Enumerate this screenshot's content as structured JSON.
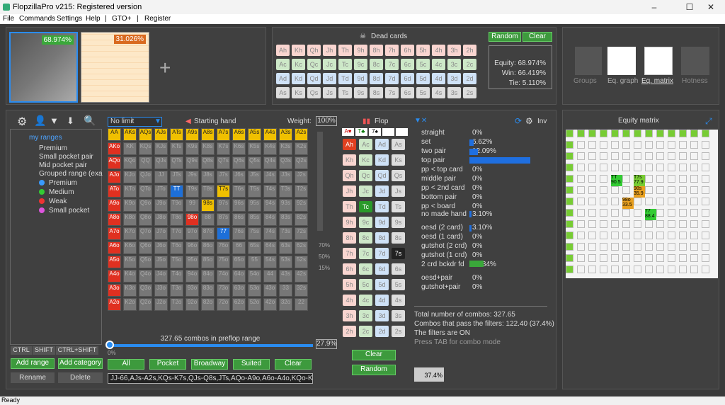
{
  "window": {
    "title": "FlopzillaPro v215: Registered version"
  },
  "menu": [
    "File",
    "Commands",
    "Settings",
    "Help",
    "|",
    "GTO+",
    "|",
    "Register"
  ],
  "ranges": {
    "r1_equity": "68.974%",
    "r2_equity": "31.026%"
  },
  "dead": {
    "title": "Dead cards",
    "random": "Random",
    "clear": "Clear",
    "rows": [
      [
        "Ah",
        "Kh",
        "Qh",
        "Jh",
        "Th",
        "9h",
        "8h",
        "7h",
        "6h",
        "5h",
        "4h",
        "3h",
        "2h"
      ],
      [
        "Ac",
        "Kc",
        "Qc",
        "Jc",
        "Tc",
        "9c",
        "8c",
        "7c",
        "6c",
        "5c",
        "4c",
        "3c",
        "2c"
      ],
      [
        "Ad",
        "Kd",
        "Qd",
        "Jd",
        "Td",
        "9d",
        "8d",
        "7d",
        "6d",
        "5d",
        "4d",
        "3d",
        "2d"
      ],
      [
        "As",
        "Ks",
        "Qs",
        "Js",
        "Ts",
        "9s",
        "8s",
        "7s",
        "6s",
        "5s",
        "4s",
        "3s",
        "2s"
      ]
    ],
    "equity": "Equity: 68.974%",
    "win": "Win: 66.419%",
    "tie": "Tie: 5.110%"
  },
  "views": {
    "groups": "Groups",
    "eqgraph": "Eq. graph",
    "eqmatrix": "Eq. matrix",
    "hotness": "Hotness"
  },
  "tree": {
    "root": "my ranges",
    "items": [
      "Premium",
      "Small pocket pair",
      "Mid pocket pair",
      "Grouped range (exam"
    ],
    "sub": [
      "Premium",
      "Medium",
      "Weak",
      "Small pocket"
    ],
    "ctrl": "CTRL",
    "shift": "SHIFT",
    "ctrlshift": "CTRL+SHIFT",
    "add_range": "Add range",
    "add_category": "Add category",
    "rename": "Rename",
    "delete": "Delete"
  },
  "hand": {
    "limit": "No limit",
    "starting": "Starting hand",
    "weight_label": "Weight:",
    "weight": "100%",
    "combos": "327.65 combos in preflop range",
    "pct": "27.9%",
    "slider_min": "0%",
    "marks": [
      "70%",
      "50%",
      "15%"
    ],
    "btn_all": "All",
    "btn_pocket": "Pocket",
    "btn_broadway": "Broadway",
    "btn_suited": "Suited",
    "btn_clear": "Clear",
    "range_text": "JJ-66,AJs-A2s,KQs-K7s,QJs-Q8s,JTs,AQo-A9o,A6o-A4o,KQo-KTo,QJo"
  },
  "flop": {
    "title": "Flop",
    "slots": [
      "A♥",
      "T♣",
      "7♠"
    ],
    "clear": "Clear",
    "random": "Random",
    "cols": [
      [
        "Ah",
        "Kh",
        "Qh",
        "Jh",
        "Th",
        "9h",
        "8h",
        "7h",
        "6h",
        "5h",
        "4h",
        "3h",
        "2h"
      ],
      [
        "Ac",
        "Kc",
        "Qc",
        "Jc",
        "Tc",
        "9c",
        "8c",
        "7c",
        "6c",
        "5c",
        "4c",
        "3c",
        "2c"
      ],
      [
        "Ad",
        "Kd",
        "Qd",
        "Jd",
        "Td",
        "9d",
        "8d",
        "7d",
        "6d",
        "5d",
        "4d",
        "3d",
        "2d"
      ],
      [
        "As",
        "Ks",
        "Qs",
        "Js",
        "Ts",
        "9s",
        "8s",
        "7s",
        "6s",
        "5s",
        "4s",
        "3s",
        "2s"
      ]
    ]
  },
  "stats": [
    [
      "straight",
      "0%"
    ],
    [
      "set",
      "6.62%"
    ],
    [
      "two pair",
      "12.09%"
    ],
    [
      "top pair",
      "78.19%"
    ],
    [
      "pp < top card",
      "0%"
    ],
    [
      "middle pair",
      "0%"
    ],
    [
      "pp < 2nd card",
      "0%"
    ],
    [
      "bottom pair",
      "0%"
    ],
    [
      "pp < board",
      "0%"
    ],
    [
      "no made hand",
      "3.10%"
    ],
    [
      "oesd (2 card)",
      "3.10%"
    ],
    [
      "oesd (1 card)",
      "0%"
    ],
    [
      "gutshot (2 crd)",
      "0%"
    ],
    [
      "gutshot (1 crd)",
      "0%"
    ],
    [
      "2 crd bckdr fd",
      "18.34%"
    ],
    [
      "oesd+pair",
      "0%"
    ],
    [
      "gutshot+pair",
      "0%"
    ]
  ],
  "summary": {
    "l1": "Total number of combos: 327.65",
    "l2": "Combos that pass the filters: 122.40 (37.4%)",
    "l3": "The filters are ON",
    "l4": "Press TAB for combo mode",
    "inv": "Inv",
    "filter_pct": "37.4%"
  },
  "eqm": {
    "title": "Equity matrix",
    "cells": [
      [
        "TT",
        "90.5"
      ],
      [
        "T7s",
        "77.9"
      ],
      [
        "98s",
        "35.9"
      ],
      [
        "98o",
        "33.5"
      ],
      [
        "77",
        "88.4"
      ]
    ]
  },
  "status": "Ready"
}
